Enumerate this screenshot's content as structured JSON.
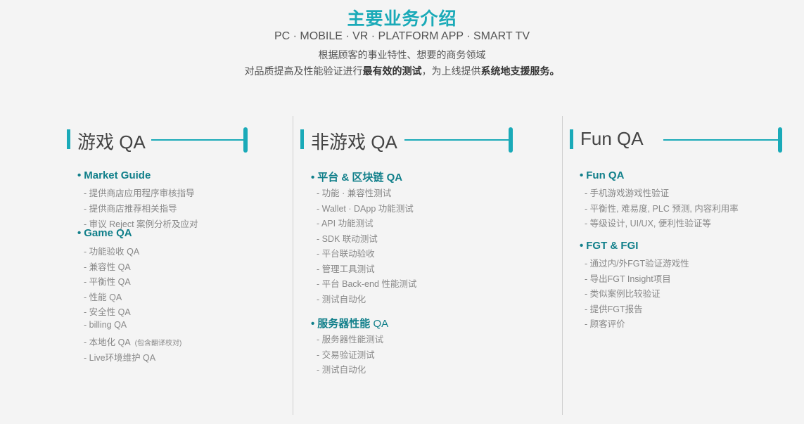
{
  "header": {
    "title": "主要业务介绍",
    "subtitle": "PC · MOBILE · VR · PLATFORM APP · SMART TV",
    "desc_line1": "根据顾客的事业特性、想要的商务领域",
    "desc_line2_a": "对品质提高及性能验证进行",
    "desc_line2_b": "最有效的测试",
    "desc_line2_c": "，为上线提供",
    "desc_line2_d": "系统地支援服务。"
  },
  "columns": [
    {
      "title": "游戏 QA",
      "sections": [
        {
          "bullet": "•",
          "title": "Market Guide",
          "items": [
            "- 提供商店应用程序审核指导",
            "- 提供商店推荐相关指导",
            "- 审议 Reject 案例分析及应对"
          ]
        },
        {
          "bullet": "•",
          "title": "Game QA",
          "items": [
            "- 功能验收 QA",
            "- 兼容性 QA",
            "- 平衡性 QA",
            "- 性能 QA",
            "- 安全性 QA",
            "- billing QA",
            "- 本地化 QA",
            "- Live环境维护 QA"
          ],
          "note": "(包含翻译校对)"
        }
      ]
    },
    {
      "title": "非游戏 QA",
      "sections": [
        {
          "bullet": "•",
          "title": "平台 & 区块链 QA",
          "items": [
            "- 功能 · 兼容性测试",
            "- Wallet · DApp 功能测试",
            "- API 功能测试",
            "- SDK 联动测试",
            "- 平台联动验收",
            "- 管理工具测试",
            "- 平台 Back-end 性能测试",
            "- 测试自动化"
          ]
        },
        {
          "bullet": "•",
          "title": "服务器性能",
          "title_suffix": " QA",
          "items": [
            "- 服务器性能测试",
            "- 交易验证测试",
            "- 测试自动化"
          ]
        }
      ]
    },
    {
      "title": "Fun QA",
      "sections": [
        {
          "bullet": "•",
          "title": "Fun QA",
          "items": [
            "- 手机游戏游戏性验证",
            "- 平衡性, 难易度, PLC 预测, 内容利用率",
            "- 等级设计, UI/UX, 便利性验证等"
          ]
        },
        {
          "bullet": "•",
          "title": "FGT & FGI",
          "items": [
            "- 通过内/外FGT验证游戏性",
            "- 导出FGT Insight项目",
            "- 类似案例比较验证",
            "- 提供FGT报告",
            "- 顾客评价"
          ]
        }
      ]
    }
  ],
  "colors": {
    "accent": "#1aaab8",
    "section": "#107f8a",
    "item": "#888888"
  }
}
